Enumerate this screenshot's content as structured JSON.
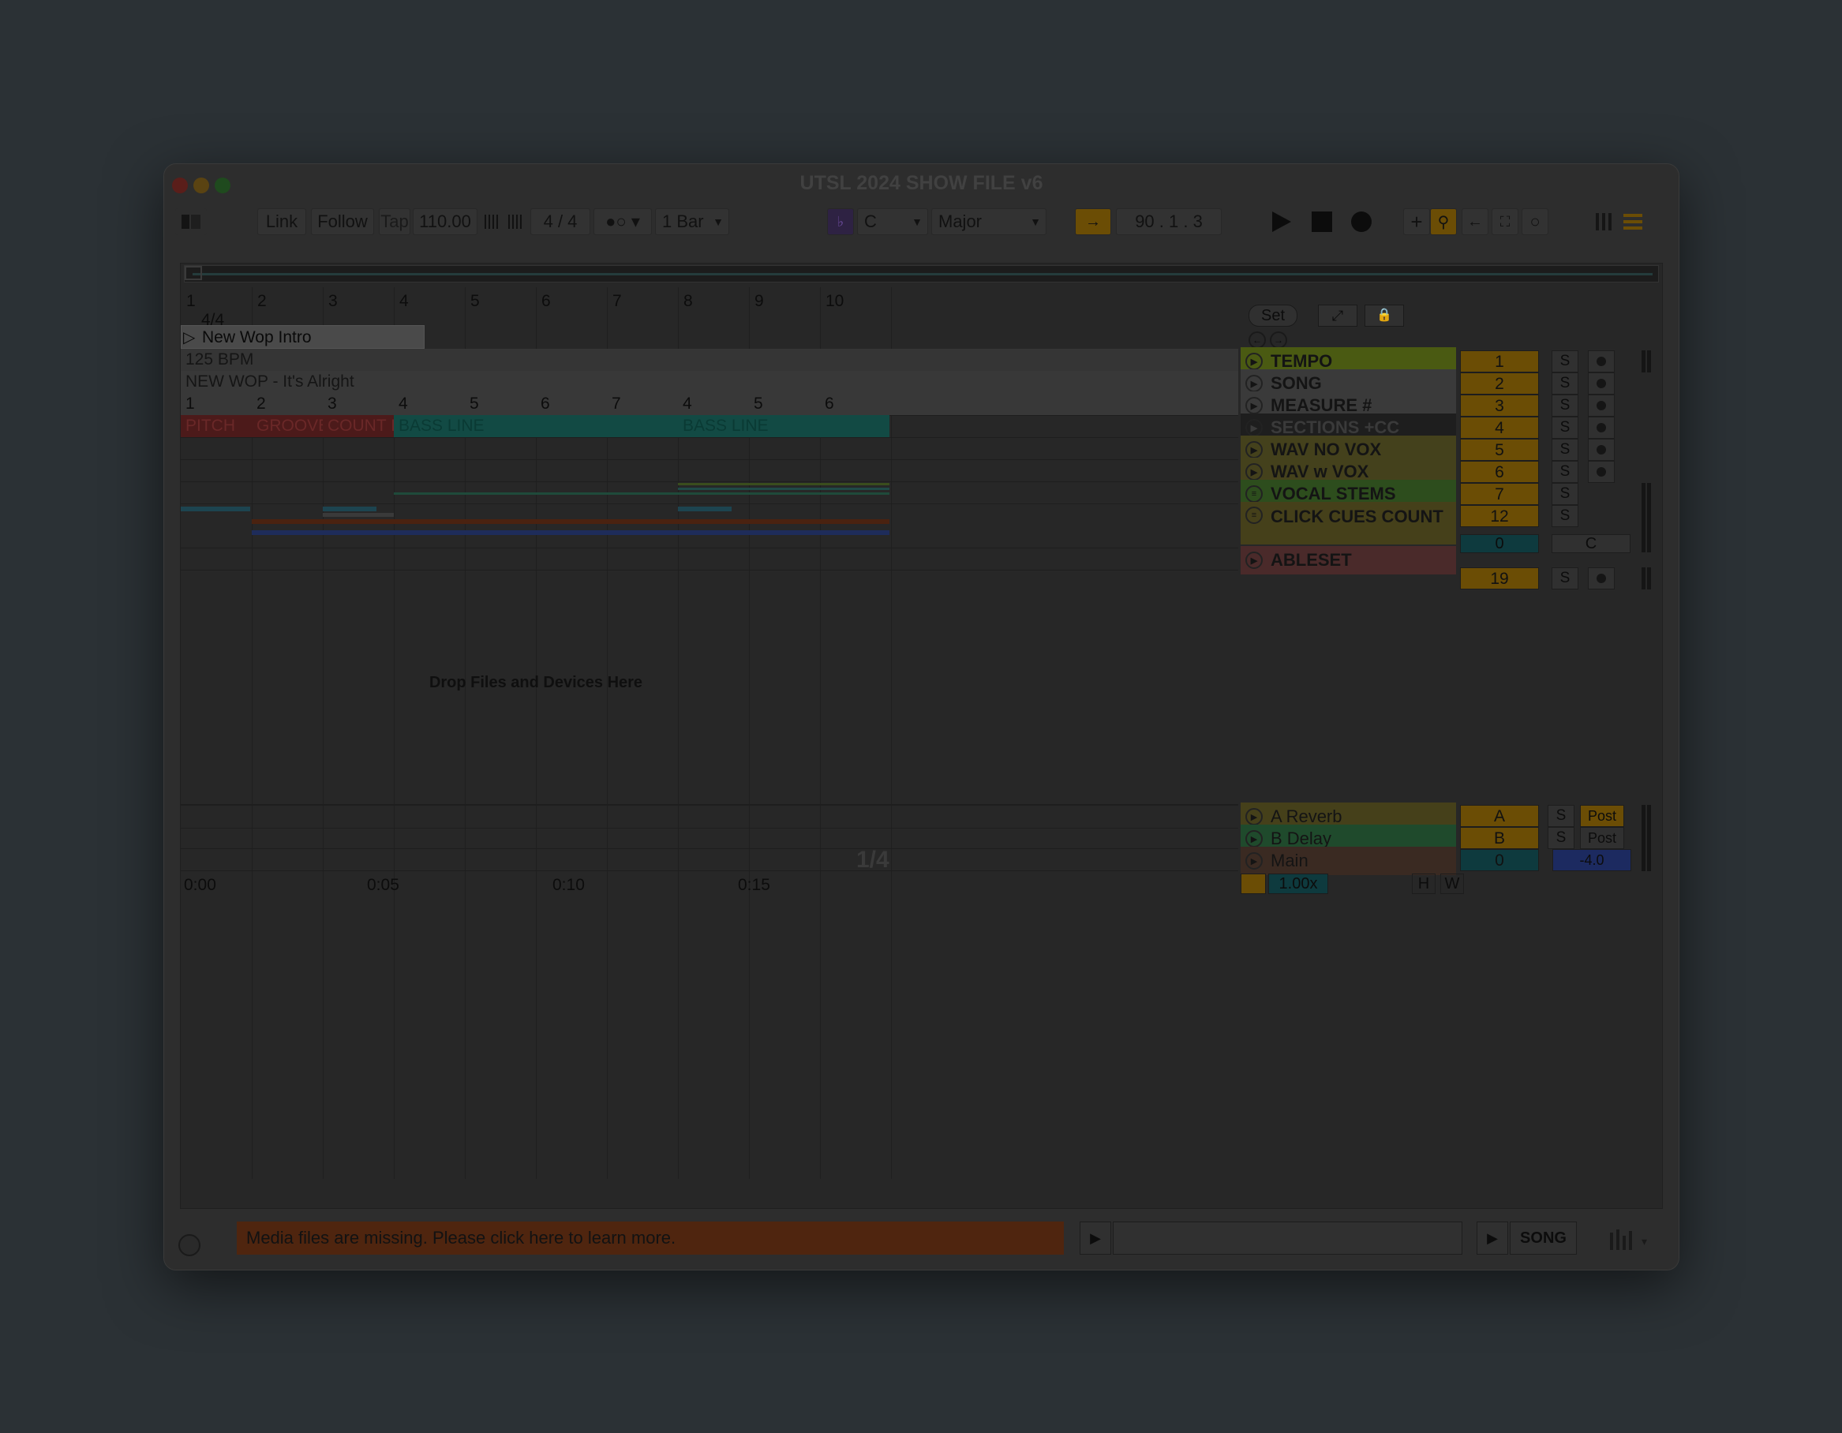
{
  "window": {
    "title": "UTSL 2024 SHOW FILE v6"
  },
  "toolbar": {
    "link": "Link",
    "follow": "Follow",
    "tap": "Tap",
    "tempo": "110.00",
    "time_signature": "4 / 4",
    "quantize": "1 Bar",
    "key": "C",
    "scale": "Major",
    "position": "90 .   1 .   3"
  },
  "ruler": {
    "bars": [
      "1",
      "2",
      "3",
      "4",
      "5",
      "6",
      "7",
      "8",
      "9",
      "10"
    ],
    "signature": "4/4",
    "locator": "New Wop Intro"
  },
  "browser_buttons": {
    "set": "Set"
  },
  "tracks": [
    {
      "name": "TEMPO",
      "number": "1",
      "solo": "S",
      "color": "#4a5a12",
      "clips": [
        {
          "text": "125 BPM"
        }
      ]
    },
    {
      "name": "SONG",
      "number": "2",
      "solo": "S",
      "color": "#353535",
      "clips": [
        {
          "text": "NEW WOP - It's Alright"
        }
      ]
    },
    {
      "name": "MEASURE #",
      "number": "3",
      "solo": "S",
      "color": "#353535",
      "clips": [
        "1",
        "2",
        "3",
        "4",
        "5",
        "6",
        "7",
        "4",
        "5",
        "6"
      ]
    },
    {
      "name": "SECTIONS +CC",
      "number": "4",
      "solo": "S",
      "color": "#1e1e1e",
      "clips": [
        "PITCH",
        "GROOVE",
        "COUNT IN",
        "BASS LINE",
        "BASS LINE"
      ]
    },
    {
      "name": "WAV NO VOX",
      "number": "5",
      "solo": "S",
      "color": "#44411c"
    },
    {
      "name": "WAV w VOX",
      "number": "6",
      "solo": "S",
      "color": "#44411c"
    },
    {
      "name": "VOCAL STEMS",
      "number": "7",
      "solo": "S",
      "color": "#2d4d1d"
    },
    {
      "name": "CLICK CUES COUNT",
      "number": "12",
      "solo": "S",
      "color": "#45401a",
      "extra": {
        "value": "0",
        "mode": "C"
      }
    },
    {
      "name": "ABLESET",
      "number": "19",
      "solo": "S",
      "color": "#4a2a2a"
    }
  ],
  "drop_zone": "Drop Files and Devices Here",
  "returns": [
    {
      "name": "A Reverb",
      "letter": "A",
      "solo": "S",
      "post": "Post",
      "color": "#45401a"
    },
    {
      "name": "B Delay",
      "letter": "B",
      "solo": "S",
      "post": "Post",
      "color": "#1f4a2c"
    },
    {
      "name": "Main",
      "value": "0",
      "volume": "-4.0",
      "color": "#3a2a22"
    }
  ],
  "quantize_overlay": "1/4",
  "time_ruler": [
    "0:00",
    "0:05",
    "0:10",
    "0:15"
  ],
  "zoom": {
    "value": "1.00x",
    "h": "H",
    "w": "W"
  },
  "status": {
    "message": "Media files are missing. Please click here to learn more.",
    "song_label": "SONG"
  },
  "colors": {
    "accent": "#6b4d05",
    "warning": "#4f250f"
  }
}
